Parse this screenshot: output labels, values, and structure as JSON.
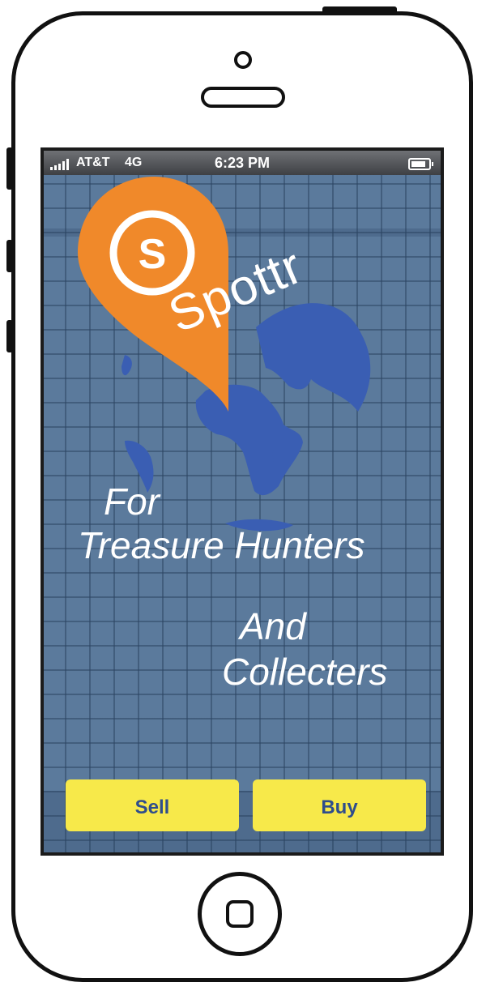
{
  "status_bar": {
    "carrier": "AT&T",
    "network": "4G",
    "time": "6:23 PM"
  },
  "app": {
    "logo_letter": "S",
    "name": "Spottr"
  },
  "tagline": {
    "line1": "For",
    "line2": "Treasure Hunters",
    "line3": "And",
    "line4": "Collecters"
  },
  "buttons": {
    "sell": "Sell",
    "buy": "Buy"
  },
  "colors": {
    "background": "#5b7a9c",
    "pin": "#f0892a",
    "globe": "#3a5eb3",
    "button": "#f7e94a",
    "button_text": "#2f4d8c"
  },
  "icons": [
    "signal-icon",
    "battery-icon",
    "location-pin-icon",
    "globe-icon"
  ]
}
